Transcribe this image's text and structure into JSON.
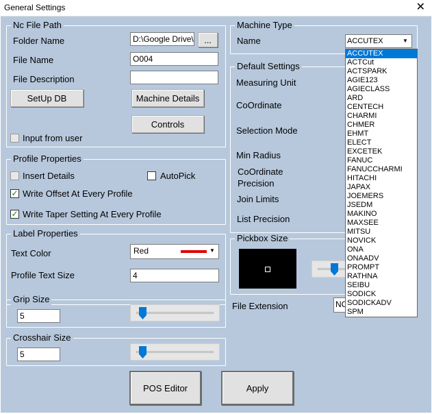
{
  "window": {
    "title": "General Settings",
    "close_glyph": "✕"
  },
  "nc_file_path": {
    "title": "Nc File Path",
    "folder_label": "Folder Name",
    "folder_value": "D:\\Google Drive\\S",
    "browse_label": "...",
    "file_label": "File Name",
    "file_value": "O004",
    "desc_label": "File Description",
    "desc_value": "",
    "setup_db": "SetUp DB",
    "machine_details": "Machine Details",
    "controls": "Controls",
    "input_from_user": "Input from user"
  },
  "profile_properties": {
    "title": "Profile Properties",
    "insert_details": "Insert Details",
    "autopick": "AutoPick",
    "write_offset": "Write Offset At Every Profile",
    "write_taper": "Write Taper Setting At Every Profile",
    "check_glyph": "✓"
  },
  "label_properties": {
    "title": "Label Properties",
    "text_color_label": "Text Color",
    "text_color_value": "Red",
    "swatch_color": "#e00000",
    "profile_text_size_label": "Profile Text Size",
    "profile_text_size_value": "4"
  },
  "grip_size": {
    "title": "Grip Size",
    "value": "5"
  },
  "crosshair_size": {
    "title": "Crosshair Size",
    "value": "5"
  },
  "machine_type": {
    "title": "Machine Type",
    "name_label": "Name",
    "selected": "ACCUTEX",
    "options": [
      "ACCUTEX",
      "ACTCut",
      "ACTSPARK",
      "AGIE123",
      "AGIECLASS",
      "ARD",
      "CENTECH",
      "CHARMI",
      "CHMER",
      "EHMT",
      "ELECT",
      "EXCETEK",
      "FANUC",
      "FANUCCHARMI",
      "HITACHI",
      "JAPAX",
      "JOEMERS",
      "JSEDM",
      "MAKINO",
      "MAXSEE",
      "MITSU",
      "NOVICK",
      "ONA",
      "ONAADV",
      "PROMPT",
      "RATHNA",
      "SEIBU",
      "SODICK",
      "SODICKADV",
      "SPM"
    ]
  },
  "default_settings": {
    "title": "Default Settings",
    "measuring_unit": "Measuring Unit",
    "coordinate": "CoOrdinate",
    "selection_mode": "Selection Mode",
    "min_radius": "Min Radius",
    "coordinate_precision_1": "CoOrdinate",
    "coordinate_precision_2": "Precision",
    "join_limits": "Join Limits",
    "list_precision": "List Precision"
  },
  "pickbox": {
    "title": "Pickbox Size"
  },
  "file_extension": {
    "label": "File Extension",
    "value": "NC"
  },
  "buttons": {
    "pos_editor": "POS Editor",
    "apply": "Apply"
  },
  "colors": {
    "background": "#b7c8dc",
    "selection": "#0078d7",
    "slider": "#0078d7"
  }
}
